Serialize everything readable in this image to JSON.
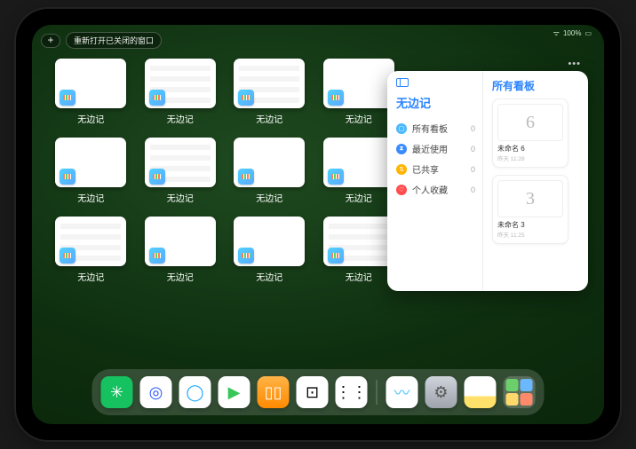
{
  "status": {
    "signal": "•••",
    "battery": "100%"
  },
  "topbar": {
    "plus": "+",
    "reopen_label": "重新打开已关闭的窗口"
  },
  "thumbs": {
    "label": "无边记",
    "count": 12,
    "with_content_indices": [
      1,
      2,
      5,
      8,
      11
    ]
  },
  "sidepanel": {
    "more": "•••",
    "left_title": "无边记",
    "right_title": "所有看板",
    "items": [
      {
        "label": "所有看板",
        "count": 0,
        "color": "#4ab8ff",
        "glyph": "▢"
      },
      {
        "label": "最近使用",
        "count": 0,
        "color": "#3a8bff",
        "glyph": "⧗"
      },
      {
        "label": "已共享",
        "count": 0,
        "color": "#ffb400",
        "glyph": "⇅"
      },
      {
        "label": "个人收藏",
        "count": 0,
        "color": "#ff4d4d",
        "glyph": "♡"
      }
    ],
    "boards": [
      {
        "name": "未命名 6",
        "time": "昨天 11:28",
        "glyph": "6"
      },
      {
        "name": "未命名 3",
        "time": "昨天 11:25",
        "glyph": "3"
      }
    ]
  },
  "dock": {
    "apps": [
      {
        "name": "wechat",
        "bg": "#16c160",
        "glyph": "✳",
        "fg": "#fff"
      },
      {
        "name": "browser1",
        "bg": "#ffffff",
        "glyph": "◎",
        "fg": "#2b57ff"
      },
      {
        "name": "browser2",
        "bg": "#ffffff",
        "glyph": "◯",
        "fg": "#1aa7ff"
      },
      {
        "name": "media",
        "bg": "#ffffff",
        "glyph": "▶",
        "fg": "#37c759"
      },
      {
        "name": "books",
        "bg": "linear-gradient(180deg,#ffb347,#ff8a00)",
        "glyph": "▯▯",
        "fg": "#fff"
      },
      {
        "name": "dice",
        "bg": "#ffffff",
        "glyph": "⊡",
        "fg": "#000"
      },
      {
        "name": "connect",
        "bg": "#ffffff",
        "glyph": "⋮⋮",
        "fg": "#000"
      }
    ],
    "recent": [
      {
        "name": "freeform",
        "bg": "#ffffff",
        "glyph": "〰",
        "fg": "#43c3ff"
      },
      {
        "name": "settings",
        "bg": "linear-gradient(180deg,#cfd3da,#9ea3ac)",
        "glyph": "⚙",
        "fg": "#555"
      },
      {
        "name": "notes",
        "bg": "linear-gradient(180deg,#fff 62%,#ffe06a 62%)",
        "glyph": "",
        "fg": "#000"
      }
    ],
    "folder_apps": [
      "a",
      "b",
      "c",
      "d"
    ]
  }
}
